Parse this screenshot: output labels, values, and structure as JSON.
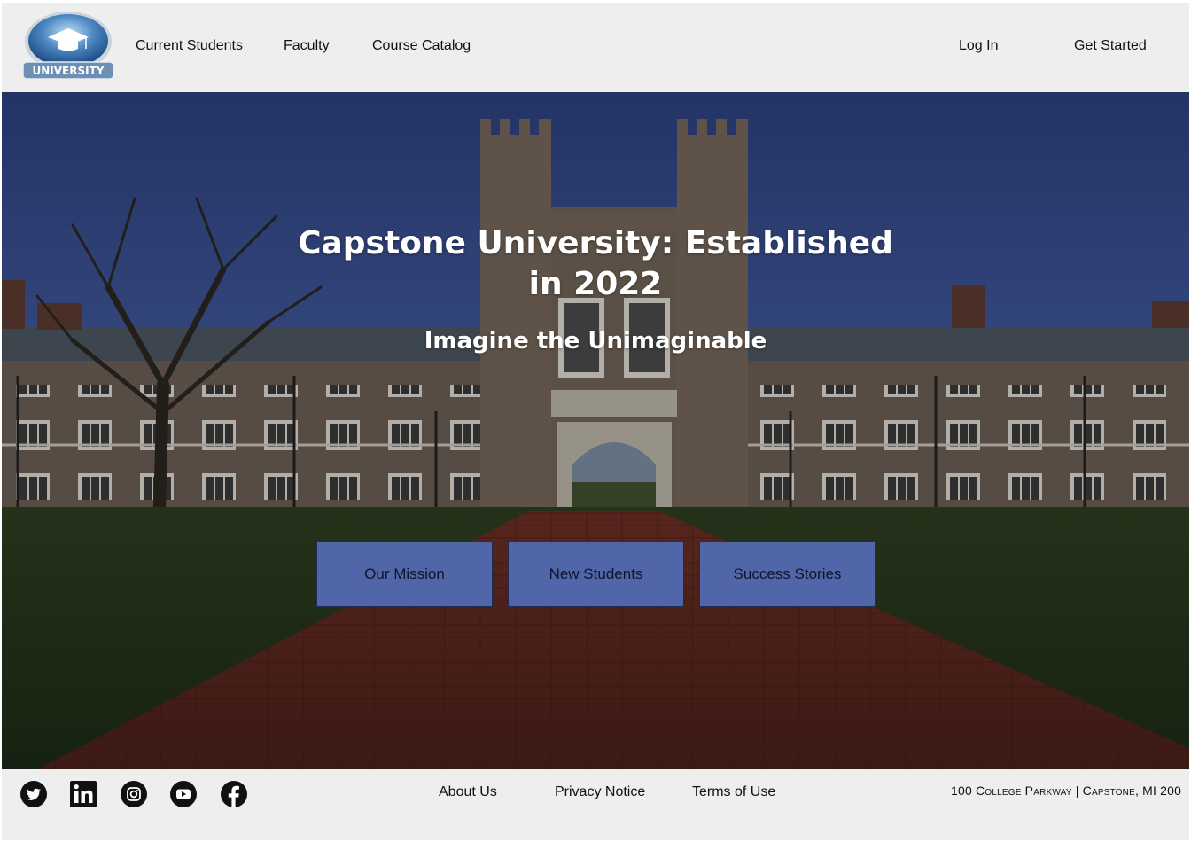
{
  "header": {
    "logo_text": "UNIVERSITY",
    "nav": [
      {
        "label": "Current Students"
      },
      {
        "label": "Faculty"
      },
      {
        "label": "Course Catalog"
      }
    ],
    "login_label": "Log In",
    "get_started_label": "Get Started"
  },
  "hero": {
    "title": "Capstone University: Established in 2022",
    "subtitle": "Imagine the Unimaginable",
    "buttons": [
      {
        "label": "Our Mission"
      },
      {
        "label": "New Students"
      },
      {
        "label": "Success Stories"
      }
    ]
  },
  "footer": {
    "social_icons": [
      "twitter-icon",
      "linkedin-icon",
      "instagram-icon",
      "youtube-icon",
      "facebook-icon"
    ],
    "links": [
      {
        "label": "About Us"
      },
      {
        "label": "Privacy Notice"
      },
      {
        "label": "Terms of Use"
      }
    ],
    "address": "100 College Parkway | Capstone, MI 200"
  },
  "colors": {
    "header_bg": "#eeeeee",
    "hero_button_bg": "#5066a8",
    "hero_button_border": "#1f2a55",
    "text": "#111111"
  }
}
